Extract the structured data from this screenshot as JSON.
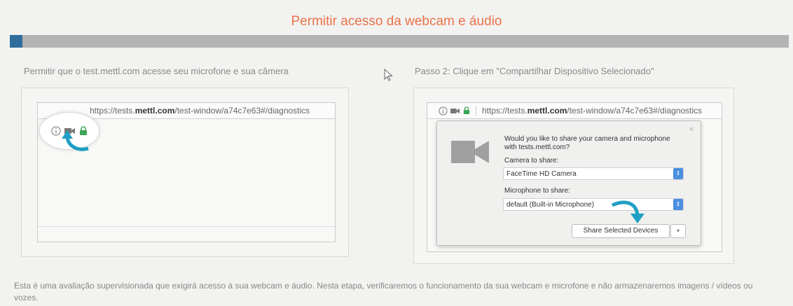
{
  "header": {
    "title": "Permitir acesso da webcam e áudio",
    "progress_fraction": 0.016,
    "colors": {
      "title": "#e8734a",
      "progress_fill": "#2f6e9c",
      "progress_track": "#b3b3b3"
    }
  },
  "step1": {
    "label": "Permitir que o test.mettl.com acesse seu microfone e sua câmera",
    "url_prefix": "https://tests.",
    "url_domain": "mettl.com",
    "url_path": "/test-window/a74c7e63#/diagnostics",
    "icons": [
      "info-icon",
      "camera-icon",
      "lock-icon",
      "arrow-icon"
    ]
  },
  "step2": {
    "label": "Passo 2: Clique em \"Compartilhar Dispositivo Selecionado\"",
    "url_prefix": "https://tests.",
    "url_domain": "mettl.com",
    "url_path": "/test-window/a74c7e63#/diagnostics",
    "popup": {
      "question": "Would you like to share your camera and microphone with tests.mettl.com?",
      "camera_label": "Camera to share:",
      "camera_value": "FaceTime HD Camera",
      "mic_label": "Microphone to share:",
      "mic_value": "default (Built-in Microphone)",
      "close": "×",
      "share_button": "Share Selected Devices",
      "dropdown_arrow": "▾"
    }
  },
  "footer": {
    "text": "Esta é uma avaliação supervisionada que exigirá acesso à sua webcam e áudio. Nesta etapa, verificaremos o funcionamento da sua webcam e microfone e não armazenaremos imagens / vídeos ou vozes."
  }
}
